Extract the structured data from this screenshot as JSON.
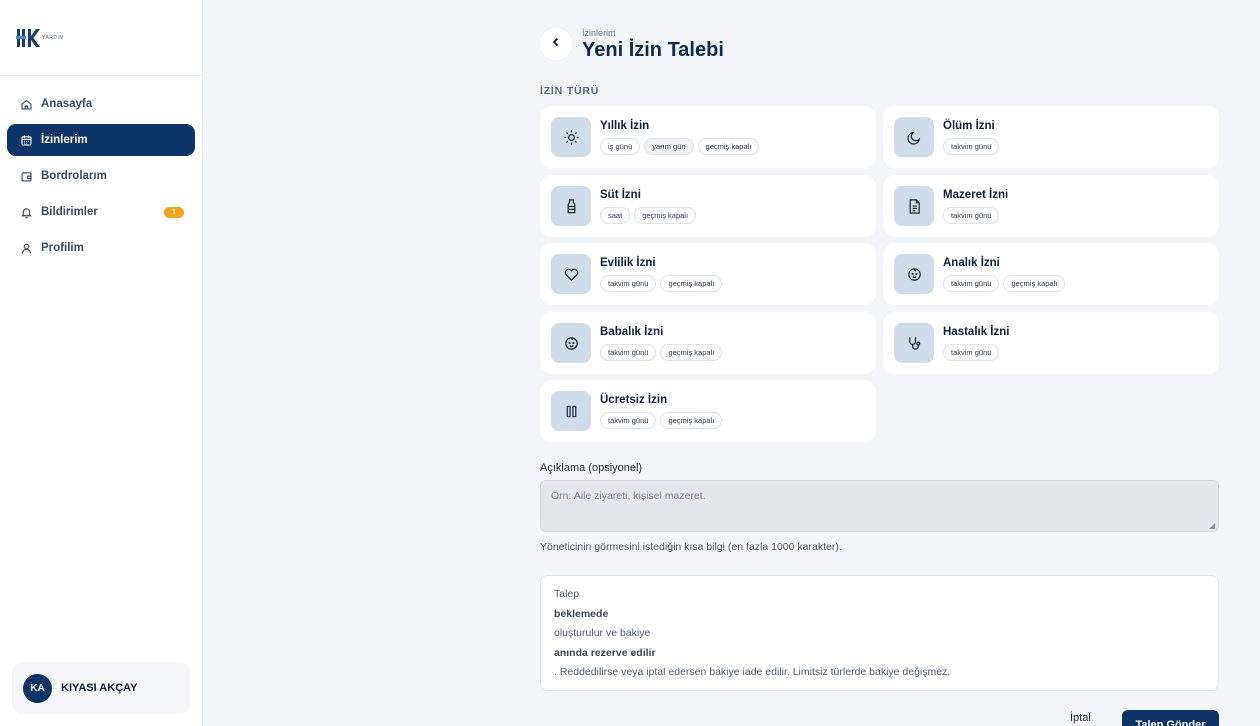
{
  "brand": {
    "logo_text": "YARDIM",
    "accent": "#0d3468"
  },
  "sidebar": {
    "items": [
      {
        "label": "Anasayfa",
        "icon": "home-icon"
      },
      {
        "label": "İzinlerim",
        "icon": "calendar-icon",
        "active": true
      },
      {
        "label": "Bordrolarım",
        "icon": "wallet-icon"
      },
      {
        "label": "Bildirimler",
        "icon": "bell-icon",
        "badge": "1"
      },
      {
        "label": "Profilim",
        "icon": "user-icon"
      }
    ],
    "user": {
      "initials": "KA",
      "name": "KIYASI AKÇAY"
    }
  },
  "header": {
    "breadcrumb": "İzinlerim",
    "title": "Yeni İzin Talebi"
  },
  "leave_types": {
    "section_label": "İZİN TÜRÜ",
    "cards": [
      {
        "title": "Yıllık İzin",
        "icon": "sun-icon",
        "tags": [
          "iş günü",
          "yarım gün",
          "geçmiş kapalı"
        ]
      },
      {
        "title": "Ölüm İzni",
        "icon": "moon-icon",
        "tags": [
          "takvim günü"
        ]
      },
      {
        "title": "Süt İzni",
        "icon": "milk-bottle-icon",
        "tags": [
          "saat",
          "geçmiş kapalı"
        ]
      },
      {
        "title": "Mazeret İzni",
        "icon": "document-icon",
        "tags": [
          "takvim günü"
        ]
      },
      {
        "title": "Evlilik İzni",
        "icon": "heart-icon",
        "tags": [
          "takvim günü",
          "geçmiş kapalı"
        ]
      },
      {
        "title": "Analık İzni",
        "icon": "baby-icon",
        "tags": [
          "takvim günü",
          "geçmiş kapalı"
        ]
      },
      {
        "title": "Babalık İzni",
        "icon": "baby-icon",
        "tags": [
          "takvim günü",
          "geçmiş kapalı"
        ]
      },
      {
        "title": "Hastalık İzni",
        "icon": "stethoscope-icon",
        "tags": [
          "takvim günü"
        ]
      },
      {
        "title": "Ücretsiz İzin",
        "icon": "pause-icon",
        "tags": [
          "takvim günü",
          "geçmiş kapalı"
        ]
      }
    ]
  },
  "description": {
    "label": "Açıklama (opsiyonel)",
    "placeholder": "Örn: Aile ziyareti, kişisel mazeret.",
    "value": "",
    "help": "Yöneticinin görmesini istediğin kısa bilgi (en fazla 1000 karakter)."
  },
  "info": {
    "lines": [
      "Talep",
      "beklemede",
      "oluşturulur ve bakiye",
      "anında rezerve edilir",
      ". Reddedilirse veya iptal edersen bakiye iade edilir. Limitsiz türlerde bakiye değişmez."
    ]
  },
  "actions": {
    "cancel": "İptal",
    "submit": "Talep Gönder"
  }
}
